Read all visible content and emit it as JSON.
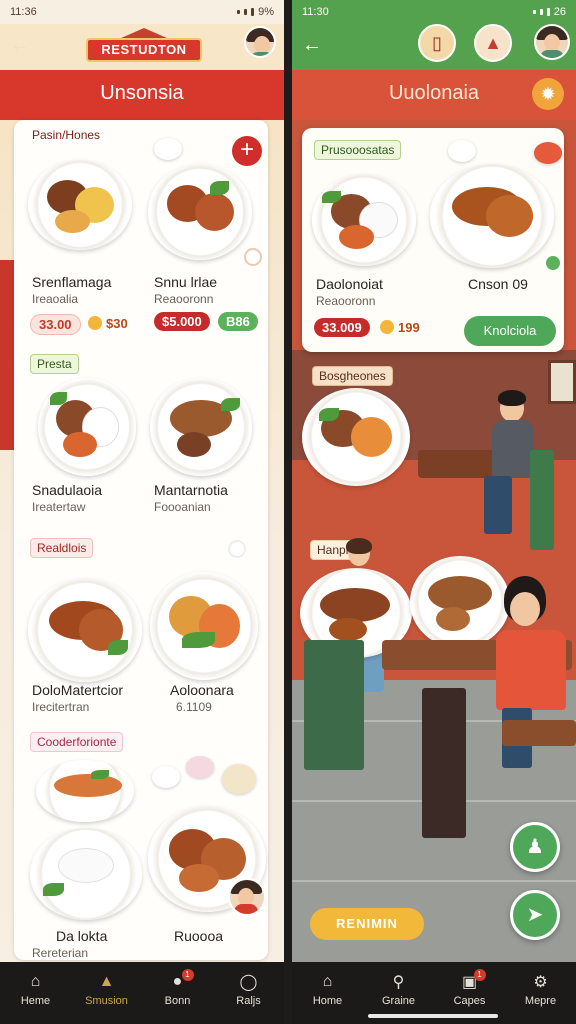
{
  "left": {
    "status": {
      "time": "11:36",
      "battery": "9%"
    },
    "logo": "RESTUDTON",
    "title": "Unsonsia",
    "sections": [
      {
        "tag": "Pasin/Hones"
      },
      {
        "tag": "Presta"
      },
      {
        "tag": "Realdlois"
      },
      {
        "tag": "Cooderforionte"
      }
    ],
    "dishes": [
      {
        "name": "Srenflamaga",
        "sub": "Ireaoalia",
        "price": "33.00",
        "alt_price": "$30"
      },
      {
        "name": "Snnu lrlae",
        "sub": "Reaooronn",
        "price": "$5.000",
        "alt_price": "B86"
      },
      {
        "name": "Snadulaoia",
        "sub": "Ireatertaw",
        "price": "",
        "alt_price": ""
      },
      {
        "name": "Mantarnotia",
        "sub": "Foooanian",
        "price": "",
        "alt_price": ""
      },
      {
        "name": "DoloMatertcior",
        "sub": "Irecitertran",
        "price": "",
        "alt_price": ""
      },
      {
        "name": "Aoloonara",
        "sub": "6.1109",
        "price": "",
        "alt_price": ""
      },
      {
        "name": "Da lokta",
        "sub": "Rereterian",
        "price": "",
        "alt_price": ""
      },
      {
        "name": "Ruoooa",
        "sub": "",
        "price": "",
        "alt_price": ""
      }
    ],
    "nav": [
      {
        "label": "Heme",
        "icon": "home-icon"
      },
      {
        "label": "Smusion",
        "icon": "profile-icon"
      },
      {
        "label": "Bonn",
        "icon": "orders-icon",
        "badge": "1"
      },
      {
        "label": "Raljs",
        "icon": "help-icon"
      }
    ]
  },
  "right": {
    "status": {
      "time": "11:30",
      "battery": "26"
    },
    "title": "Uuolonaia",
    "featured": {
      "tag": "Prusooosatas",
      "name": "Daolonoiat",
      "sub": "Reaooronn",
      "alt_name": "Cnson 09",
      "price": "33.009",
      "coin_price": "199",
      "cta": "Knolciola"
    },
    "scene_tags": [
      "Bosgheones",
      "Hanple"
    ],
    "reserve": "RENIMIN",
    "nav": [
      {
        "label": "Home",
        "icon": "home-icon"
      },
      {
        "label": "Graine",
        "icon": "search-icon"
      },
      {
        "label": "Capes",
        "icon": "cart-icon",
        "badge": "1"
      },
      {
        "label": "Mepre",
        "icon": "settings-icon"
      }
    ]
  },
  "colors": {
    "brand_red": "#d8372b",
    "accent_green": "#4fa85a",
    "gold": "#f1b83a"
  }
}
